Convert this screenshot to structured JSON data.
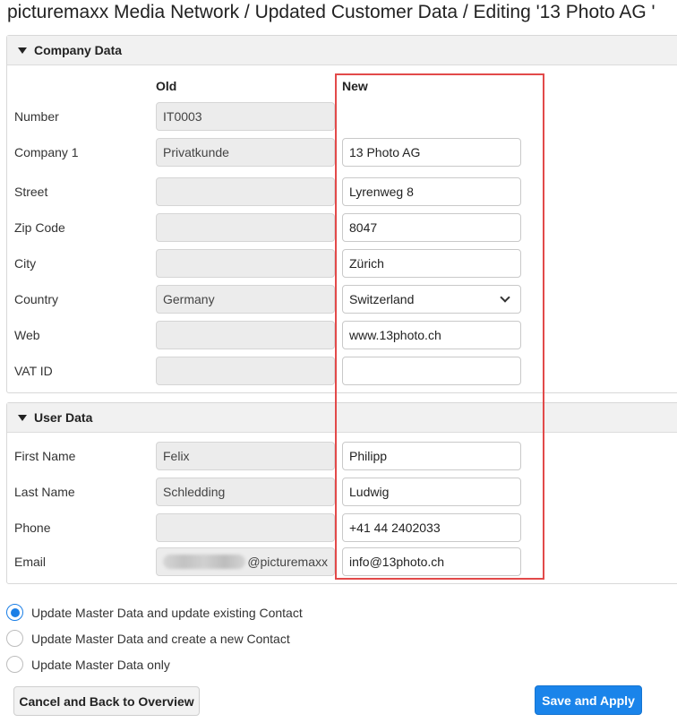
{
  "title": "picturemaxx Media Network / Updated Customer Data / Editing '13 Photo AG '",
  "company": {
    "header": "Company Data",
    "col_old": "Old",
    "col_new": "New",
    "fields": {
      "number": {
        "label": "Number",
        "old": "IT0003"
      },
      "company1": {
        "label": "Company 1",
        "old": "Privatkunde",
        "new": "13 Photo AG"
      },
      "street": {
        "label": "Street",
        "old": "",
        "new": "Lyrenweg 8"
      },
      "zip": {
        "label": "Zip Code",
        "old": "",
        "new": "8047"
      },
      "city": {
        "label": "City",
        "old": "",
        "new": "Zürich"
      },
      "country": {
        "label": "Country",
        "old": "Germany",
        "new": "Switzerland"
      },
      "web": {
        "label": "Web",
        "old": "",
        "new": "www.13photo.ch"
      },
      "vat": {
        "label": "VAT ID",
        "old": "",
        "new": ""
      }
    }
  },
  "user": {
    "header": "User Data",
    "fields": {
      "first": {
        "label": "First Name",
        "old": "Felix",
        "new": "Philipp"
      },
      "last": {
        "label": "Last Name",
        "old": "Schledding",
        "new": "Ludwig"
      },
      "phone": {
        "label": "Phone",
        "old": "",
        "new": "+41 44 2402033"
      },
      "email": {
        "label": "Email",
        "old_domain": "@picturemaxx",
        "new": "info@13photo.ch"
      }
    }
  },
  "options": [
    {
      "label": "Update Master Data and update existing Contact",
      "selected": true
    },
    {
      "label": "Update Master Data and create a new Contact",
      "selected": false
    },
    {
      "label": "Update Master Data only",
      "selected": false
    }
  ],
  "buttons": {
    "cancel": "Cancel and Back to Overview",
    "save": "Save and Apply"
  },
  "colors": {
    "primary": "#1a84ea",
    "highlight_border": "#e24a4a"
  }
}
